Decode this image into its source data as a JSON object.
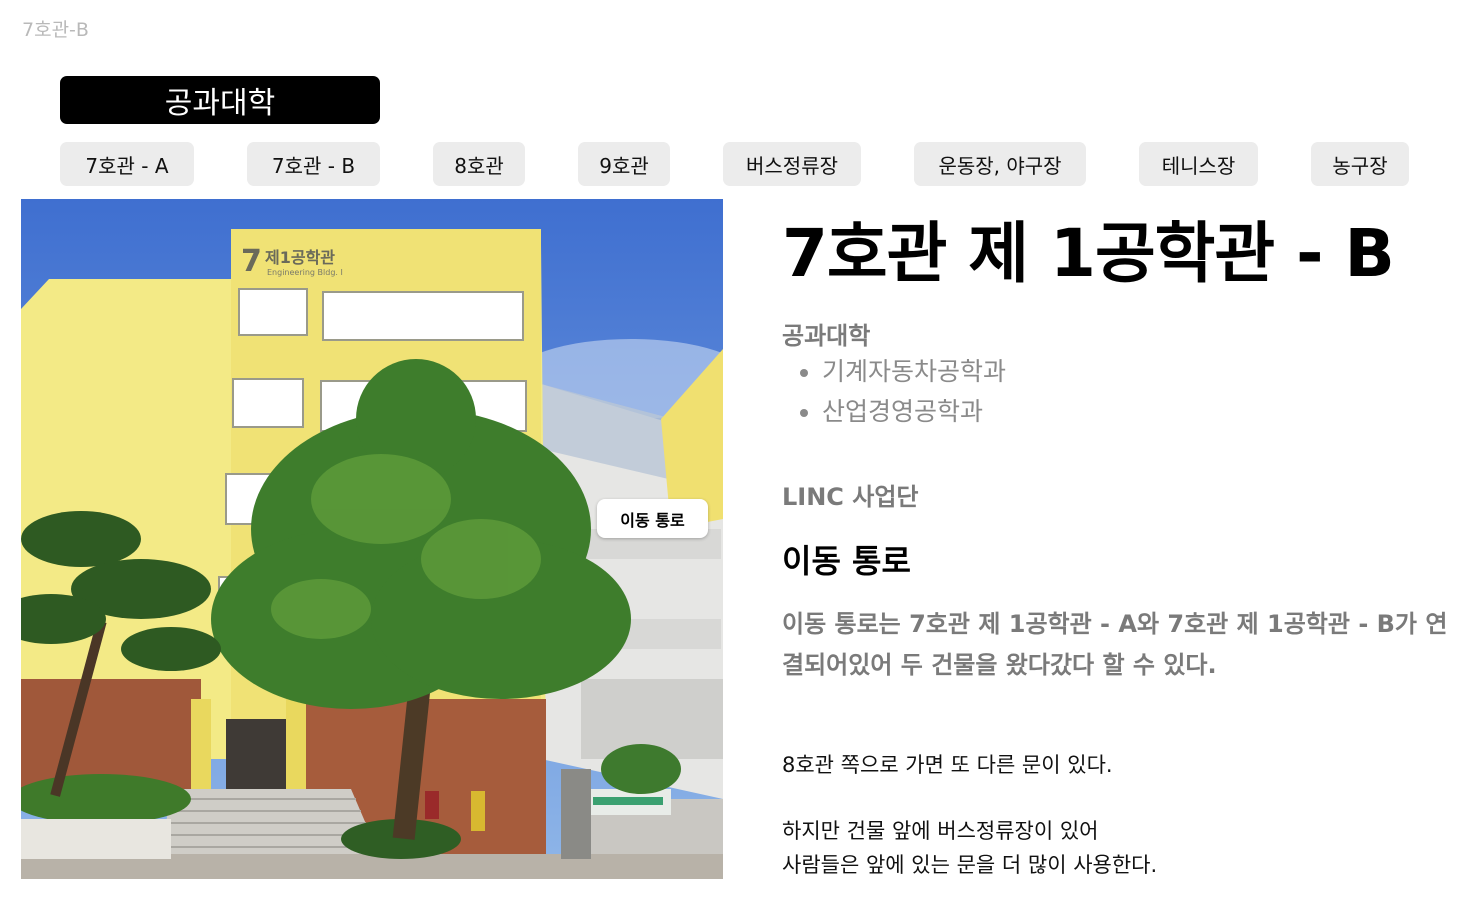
{
  "page_label": "7호관-B",
  "college_button": "공과대학",
  "tabs": [
    "7호관 - A",
    "7호관 - B",
    "8호관",
    "9호관",
    "버스정류장",
    "운동장, 야구장",
    "테니스장",
    "농구장"
  ],
  "photo": {
    "route_tag": "이동 통로",
    "sign_number": "7",
    "sign_korean": "제1공학관",
    "sign_english": "Engineering Bldg. I"
  },
  "building": {
    "title": "7호관 제 1공학관 - B",
    "college": "공과대학",
    "departments": [
      "기계자동차공학과",
      "산업경영공학과"
    ],
    "organization": "LINC 사업단"
  },
  "route": {
    "heading": "이동 통로",
    "description": "이동 통로는 7호관 제 1공학관 - A와 7호관 제 1공학관 - B가 연결되어있어 두 건물을 왔다갔다 할 수 있다.",
    "note1": "8호관 쪽으로 가면 또 다른 문이 있다.",
    "note2_line1": "하지만 건물 앞에 버스정류장이 있어",
    "note2_line2": "사람들은 앞에 있는 문을 더 많이 사용한다."
  }
}
